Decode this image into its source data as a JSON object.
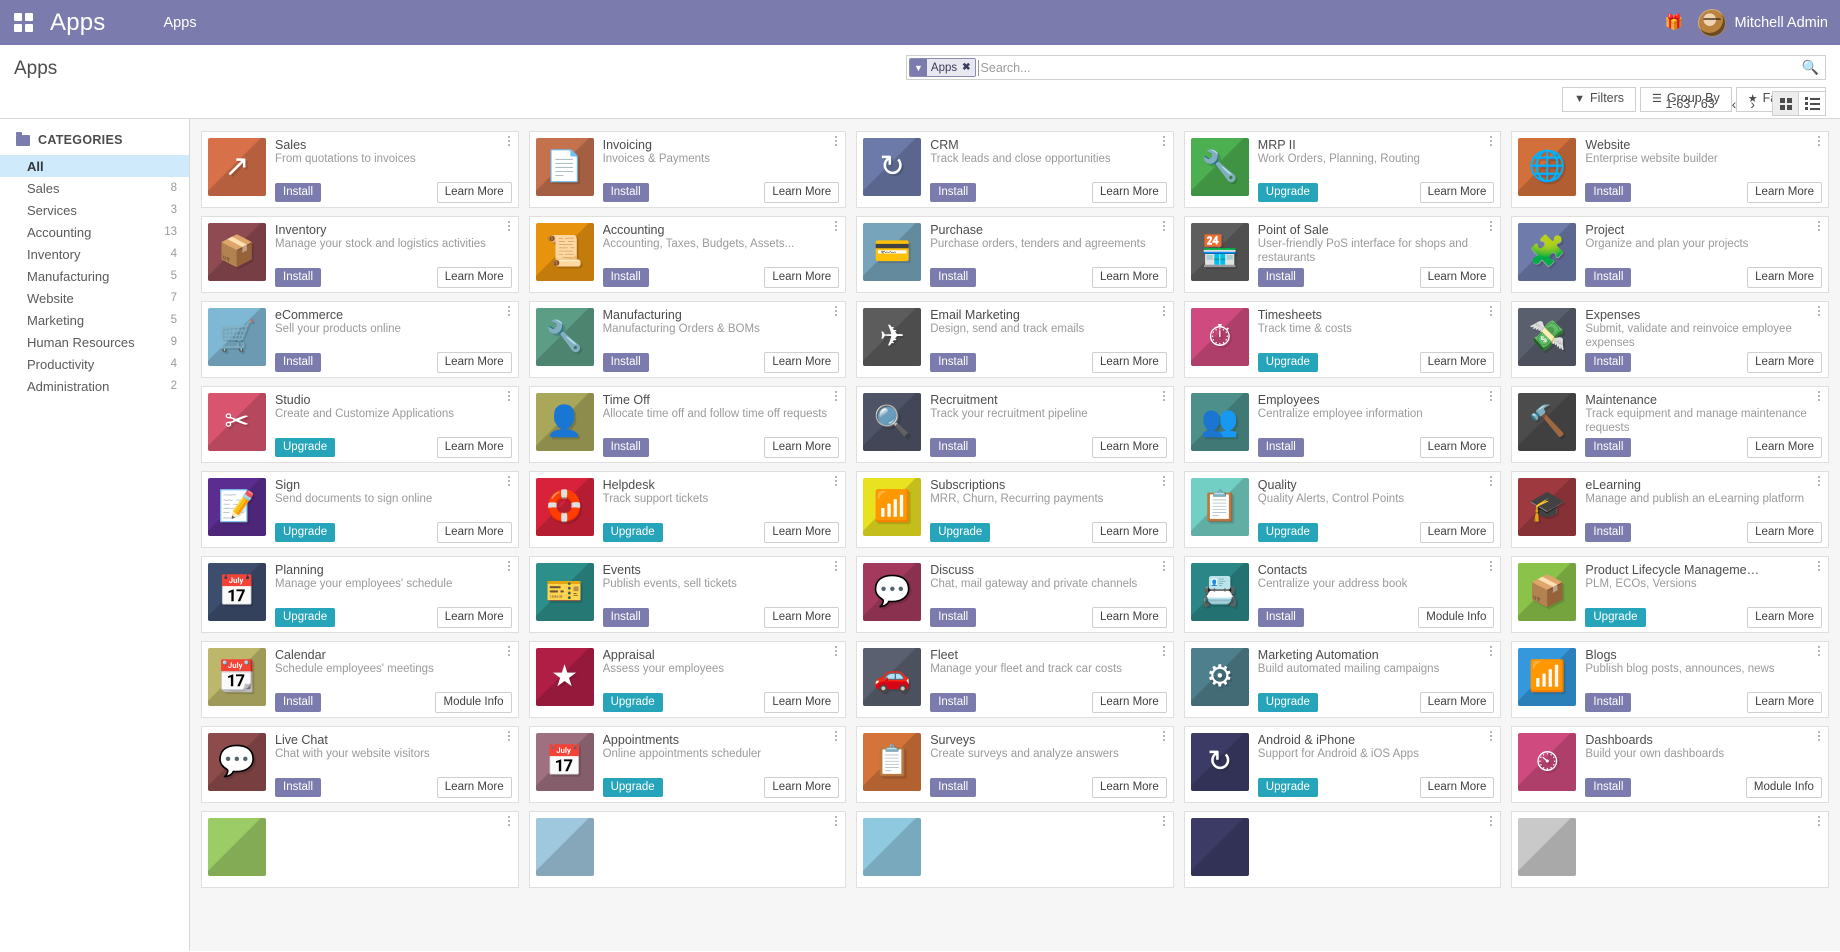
{
  "navbar": {
    "brand": "Apps",
    "menu_item": "Apps",
    "gift_icon": "gift-icon",
    "user_name": "Mitchell Admin"
  },
  "control_panel": {
    "title": "Apps",
    "search": {
      "facet_label": "Apps",
      "facet_remove": "✖",
      "placeholder": "Search..."
    },
    "filters_label": "Filters",
    "group_by_label": "Group By",
    "favorites_label": "Favorites",
    "pager": "1-63 / 63",
    "prev_arrow": "‹",
    "next_arrow": "›",
    "active_view": "kanban"
  },
  "sidebar": {
    "header": "CATEGORIES",
    "items": [
      {
        "label": "All",
        "count": "",
        "active": true
      },
      {
        "label": "Sales",
        "count": "8"
      },
      {
        "label": "Services",
        "count": "3"
      },
      {
        "label": "Accounting",
        "count": "13"
      },
      {
        "label": "Inventory",
        "count": "4"
      },
      {
        "label": "Manufacturing",
        "count": "5"
      },
      {
        "label": "Website",
        "count": "7"
      },
      {
        "label": "Marketing",
        "count": "5"
      },
      {
        "label": "Human Resources",
        "count": "9"
      },
      {
        "label": "Productivity",
        "count": "4"
      },
      {
        "label": "Administration",
        "count": "2"
      }
    ]
  },
  "apps": [
    {
      "name": "Sales",
      "desc": "From quotations to invoices",
      "action": "Install",
      "action_type": "install",
      "secondary": "Learn More",
      "color": "#d8714a",
      "glyph": "↗"
    },
    {
      "name": "Invoicing",
      "desc": "Invoices & Payments",
      "action": "Install",
      "action_type": "install",
      "secondary": "Learn More",
      "color": "#c4714e",
      "glyph": "📄"
    },
    {
      "name": "CRM",
      "desc": "Track leads and close opportunities",
      "action": "Install",
      "action_type": "install",
      "secondary": "Learn More",
      "color": "#6b7aa8",
      "glyph": "↻"
    },
    {
      "name": "MRP II",
      "desc": "Work Orders, Planning, Routing",
      "action": "Upgrade",
      "action_type": "upgrade",
      "secondary": "Learn More",
      "color": "#4caf50",
      "glyph": "🔧"
    },
    {
      "name": "Website",
      "desc": "Enterprise website builder",
      "action": "Install",
      "action_type": "install",
      "secondary": "Learn More",
      "color": "#d2703c",
      "glyph": "🌐"
    },
    {
      "name": "Inventory",
      "desc": "Manage your stock and logistics activities",
      "action": "Install",
      "action_type": "install",
      "secondary": "Learn More",
      "color": "#8e4b52",
      "glyph": "📦"
    },
    {
      "name": "Accounting",
      "desc": "Accounting, Taxes, Budgets, Assets...",
      "action": "Install",
      "action_type": "install",
      "secondary": "Learn More",
      "color": "#e8930d",
      "glyph": "📜"
    },
    {
      "name": "Purchase",
      "desc": "Purchase orders, tenders and agreements",
      "action": "Install",
      "action_type": "install",
      "secondary": "Learn More",
      "color": "#77a4bb",
      "glyph": "💳"
    },
    {
      "name": "Point of Sale",
      "desc": "User-friendly PoS interface for shops and restaurants",
      "action": "Install",
      "action_type": "install",
      "secondary": "Learn More",
      "color": "#5e5e5e",
      "glyph": "🏪"
    },
    {
      "name": "Project",
      "desc": "Organize and plan your projects",
      "action": "Install",
      "action_type": "install",
      "secondary": "Learn More",
      "color": "#6e7bab",
      "glyph": "🧩"
    },
    {
      "name": "eCommerce",
      "desc": "Sell your products online",
      "action": "Install",
      "action_type": "install",
      "secondary": "Learn More",
      "color": "#7fb8d4",
      "glyph": "🛒"
    },
    {
      "name": "Manufacturing",
      "desc": "Manufacturing Orders & BOMs",
      "action": "Install",
      "action_type": "install",
      "secondary": "Learn More",
      "color": "#5c9d86",
      "glyph": "🔧"
    },
    {
      "name": "Email Marketing",
      "desc": "Design, send and track emails",
      "action": "Install",
      "action_type": "install",
      "secondary": "Learn More",
      "color": "#5c5c5c",
      "glyph": "✈"
    },
    {
      "name": "Timesheets",
      "desc": "Track time & costs",
      "action": "Upgrade",
      "action_type": "upgrade",
      "secondary": "Learn More",
      "color": "#cf4a7e",
      "glyph": "⏱"
    },
    {
      "name": "Expenses",
      "desc": "Submit, validate and reinvoice employee expenses",
      "action": "Install",
      "action_type": "install",
      "secondary": "Learn More",
      "color": "#5a5f6e",
      "glyph": "💸"
    },
    {
      "name": "Studio",
      "desc": "Create and Customize Applications",
      "action": "Upgrade",
      "action_type": "upgrade",
      "secondary": "Learn More",
      "color": "#d9556f",
      "glyph": "✂"
    },
    {
      "name": "Time Off",
      "desc": "Allocate time off and follow time off requests",
      "action": "Install",
      "action_type": "install",
      "secondary": "Learn More",
      "color": "#a8a75a",
      "glyph": "👤"
    },
    {
      "name": "Recruitment",
      "desc": "Track your recruitment pipeline",
      "action": "Install",
      "action_type": "install",
      "secondary": "Learn More",
      "color": "#4e5366",
      "glyph": "🔍"
    },
    {
      "name": "Employees",
      "desc": "Centralize employee information",
      "action": "Install",
      "action_type": "install",
      "secondary": "Learn More",
      "color": "#4c8f8b",
      "glyph": "👥"
    },
    {
      "name": "Maintenance",
      "desc": "Track equipment and manage maintenance requests",
      "action": "Install",
      "action_type": "install",
      "secondary": "Learn More",
      "color": "#4c4c4c",
      "glyph": "🔨"
    },
    {
      "name": "Sign",
      "desc": "Send documents to sign online",
      "action": "Upgrade",
      "action_type": "upgrade",
      "secondary": "Learn More",
      "color": "#5c2d91",
      "glyph": "📝"
    },
    {
      "name": "Helpdesk",
      "desc": "Track support tickets",
      "action": "Upgrade",
      "action_type": "upgrade",
      "secondary": "Learn More",
      "color": "#d8223c",
      "glyph": "🛟"
    },
    {
      "name": "Subscriptions",
      "desc": "MRR, Churn, Recurring payments",
      "action": "Upgrade",
      "action_type": "upgrade",
      "secondary": "Learn More",
      "color": "#e8e220",
      "glyph": "📶"
    },
    {
      "name": "Quality",
      "desc": "Quality Alerts, Control Points",
      "action": "Upgrade",
      "action_type": "upgrade",
      "secondary": "Learn More",
      "color": "#72cfc4",
      "glyph": "📋"
    },
    {
      "name": "eLearning",
      "desc": "Manage and publish an eLearning platform",
      "action": "Install",
      "action_type": "install",
      "secondary": "Learn More",
      "color": "#9e3a3f",
      "glyph": "🎓"
    },
    {
      "name": "Planning",
      "desc": "Manage your employees' schedule",
      "action": "Upgrade",
      "action_type": "upgrade",
      "secondary": "Learn More",
      "color": "#3d4d6e",
      "glyph": "📅"
    },
    {
      "name": "Events",
      "desc": "Publish events, sell tickets",
      "action": "Install",
      "action_type": "install",
      "secondary": "Learn More",
      "color": "#2d8f8a",
      "glyph": "🎫"
    },
    {
      "name": "Discuss",
      "desc": "Chat, mail gateway and private channels",
      "action": "Install",
      "action_type": "install",
      "secondary": "Learn More",
      "color": "#a33a5e",
      "glyph": "💬"
    },
    {
      "name": "Contacts",
      "desc": "Centralize your address book",
      "action": "Install",
      "action_type": "install",
      "secondary": "Module Info",
      "color": "#2b8787",
      "glyph": "📇"
    },
    {
      "name": "Product Lifecycle Manageme…",
      "desc": "PLM, ECOs, Versions",
      "action": "Upgrade",
      "action_type": "upgrade",
      "secondary": "Learn More",
      "color": "#8bc34a",
      "glyph": "📦"
    },
    {
      "name": "Calendar",
      "desc": "Schedule employees' meetings",
      "action": "Install",
      "action_type": "install",
      "secondary": "Module Info",
      "color": "#bdb76b",
      "glyph": "📆"
    },
    {
      "name": "Appraisal",
      "desc": "Assess your employees",
      "action": "Upgrade",
      "action_type": "upgrade",
      "secondary": "Learn More",
      "color": "#b01e45",
      "glyph": "★"
    },
    {
      "name": "Fleet",
      "desc": "Manage your fleet and track car costs",
      "action": "Install",
      "action_type": "install",
      "secondary": "Learn More",
      "color": "#5a6070",
      "glyph": "🚗"
    },
    {
      "name": "Marketing Automation",
      "desc": "Build automated mailing campaigns",
      "action": "Upgrade",
      "action_type": "upgrade",
      "secondary": "Learn More",
      "color": "#4e7f8c",
      "glyph": "⚙"
    },
    {
      "name": "Blogs",
      "desc": "Publish blog posts, announces, news",
      "action": "Install",
      "action_type": "install",
      "secondary": "Learn More",
      "color": "#3598dc",
      "glyph": "📶"
    },
    {
      "name": "Live Chat",
      "desc": "Chat with your website visitors",
      "action": "Install",
      "action_type": "install",
      "secondary": "Learn More",
      "color": "#8e4b4b",
      "glyph": "💬"
    },
    {
      "name": "Appointments",
      "desc": "Online appointments scheduler",
      "action": "Upgrade",
      "action_type": "upgrade",
      "secondary": "Learn More",
      "color": "#9e7080",
      "glyph": "📅"
    },
    {
      "name": "Surveys",
      "desc": "Create surveys and analyze answers",
      "action": "Install",
      "action_type": "install",
      "secondary": "Learn More",
      "color": "#d4743a",
      "glyph": "📋"
    },
    {
      "name": "Android & iPhone",
      "desc": "Support for Android & iOS Apps",
      "action": "Upgrade",
      "action_type": "upgrade",
      "secondary": "Learn More",
      "color": "#3b3b66",
      "glyph": "↻"
    },
    {
      "name": "Dashboards",
      "desc": "Build your own dashboards",
      "action": "Install",
      "action_type": "install",
      "secondary": "Module Info",
      "color": "#cf4a7e",
      "glyph": "⏲"
    },
    {
      "name": "",
      "desc": "",
      "action": "",
      "action_type": "none",
      "secondary": "",
      "color": "#9ccc65",
      "glyph": ""
    },
    {
      "name": "",
      "desc": "",
      "action": "",
      "action_type": "none",
      "secondary": "",
      "color": "#9fc7dd",
      "glyph": ""
    },
    {
      "name": "",
      "desc": "",
      "action": "",
      "action_type": "none",
      "secondary": "",
      "color": "#8fc9e0",
      "glyph": ""
    },
    {
      "name": "",
      "desc": "",
      "action": "",
      "action_type": "none",
      "secondary": "",
      "color": "#3b3b66",
      "glyph": ""
    },
    {
      "name": "",
      "desc": "",
      "action": "",
      "action_type": "none",
      "secondary": "",
      "color": "#c9c9c9",
      "glyph": ""
    }
  ]
}
